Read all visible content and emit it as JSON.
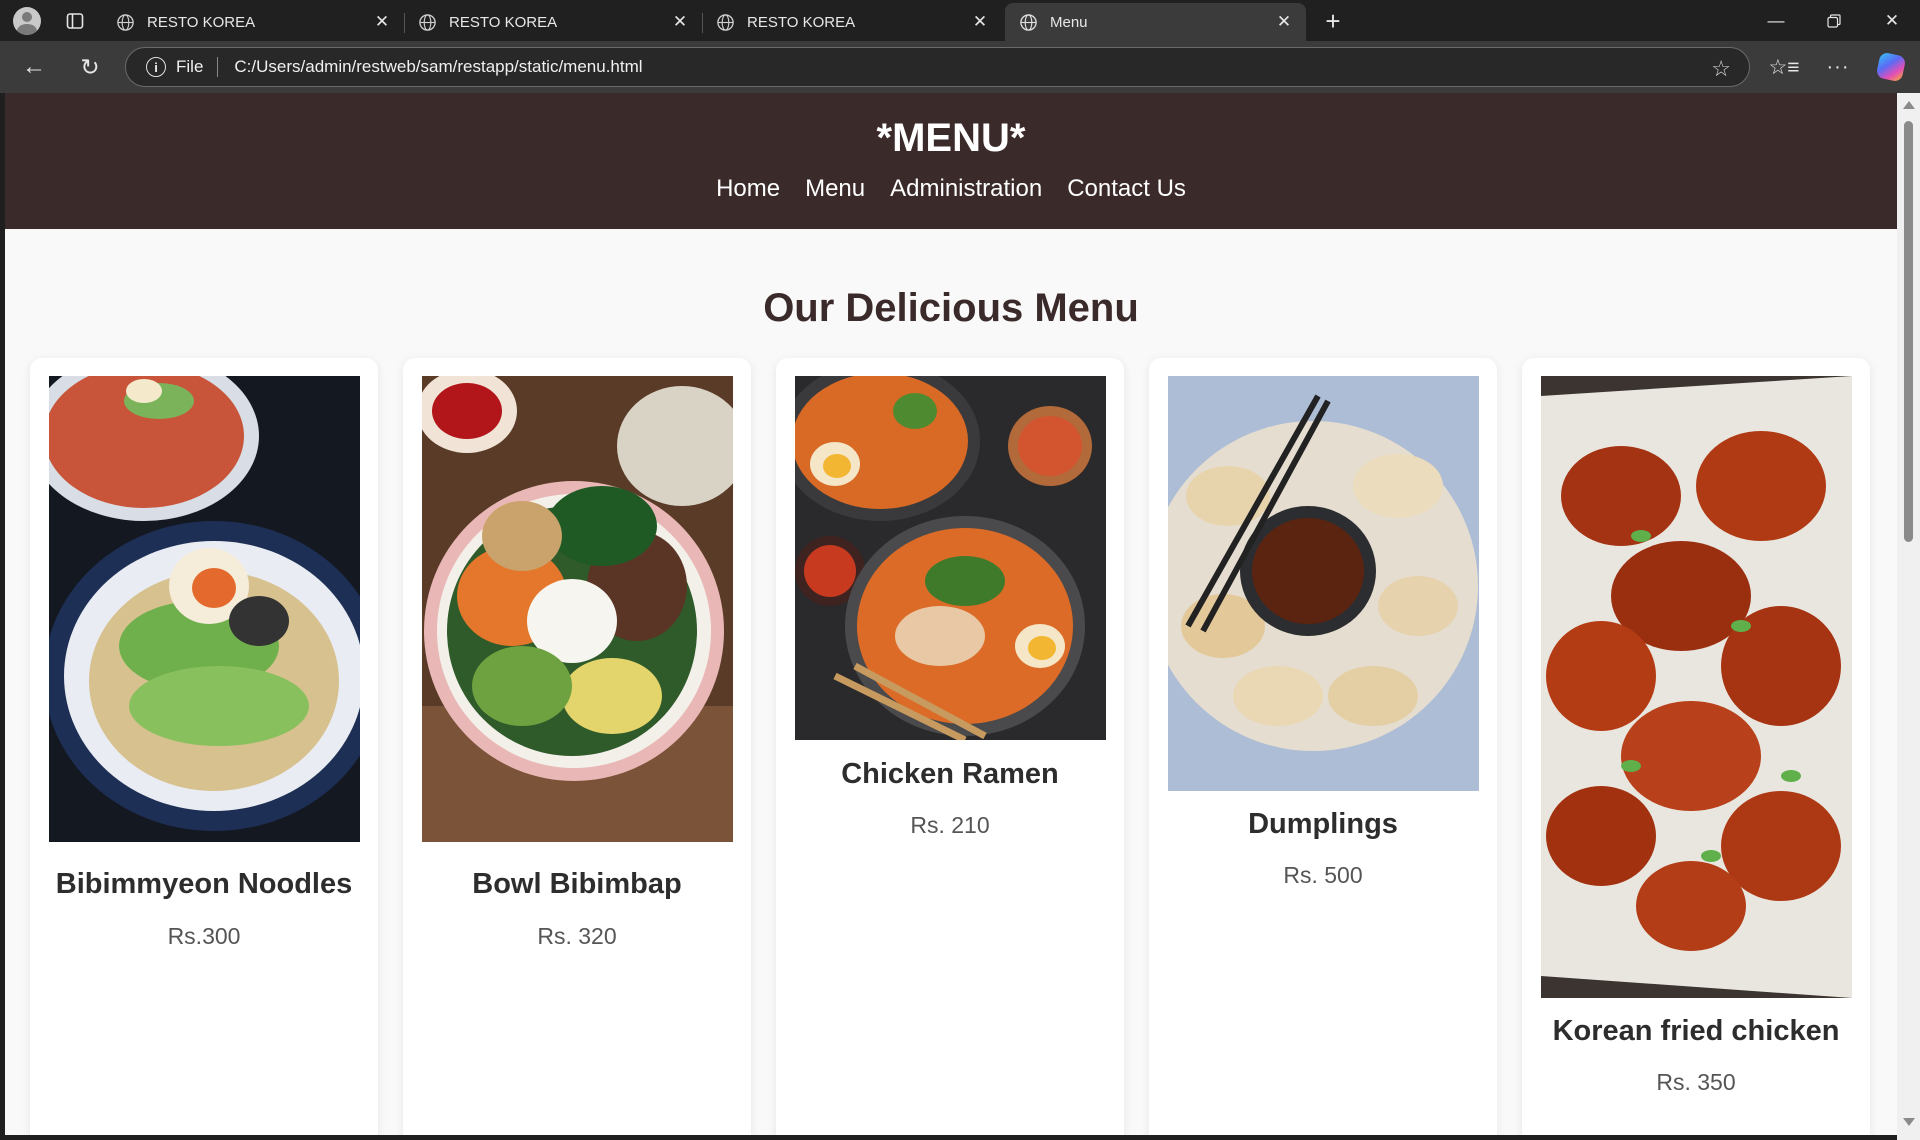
{
  "browser": {
    "tabs": [
      {
        "title": "RESTO KOREA",
        "active": false
      },
      {
        "title": "RESTO KOREA",
        "active": false
      },
      {
        "title": "RESTO KOREA",
        "active": false
      },
      {
        "title": "Menu",
        "active": true
      }
    ],
    "address": {
      "scheme_label": "File",
      "url": "C:/Users/admin/restweb/sam/restapp/static/menu.html"
    },
    "icons": {
      "profile": "avatar-icon",
      "tab_actions": "tab-actions-icon",
      "new_tab": "plus-icon",
      "minimize": "minimize-icon",
      "maximize": "restore-icon",
      "close": "close-icon",
      "back": "arrow-left-icon",
      "reload": "reload-icon",
      "favorite": "star-icon",
      "favorites": "favorites-icon",
      "more": "more-icon",
      "copilot": "copilot-icon"
    }
  },
  "site": {
    "title": "*MENU*",
    "nav": [
      {
        "label": "Home"
      },
      {
        "label": "Menu"
      },
      {
        "label": "Administration"
      },
      {
        "label": "Contact Us"
      }
    ]
  },
  "menu": {
    "heading": "Our Delicious Menu",
    "items": [
      {
        "name": "Bibimmyeon Noodles",
        "price": "Rs.300",
        "image": "bibimmyeon-noodles-photo"
      },
      {
        "name": "Bowl Bibimbap",
        "price": "Rs. 320",
        "image": "bowl-bibimbap-photo"
      },
      {
        "name": "Chicken Ramen",
        "price": "Rs. 210",
        "image": "chicken-ramen-photo"
      },
      {
        "name": "Dumplings",
        "price": "Rs. 500",
        "image": "dumplings-photo"
      },
      {
        "name": "Korean fried chicken",
        "price": "Rs. 350",
        "image": "korean-fried-chicken-photo"
      }
    ]
  },
  "colors": {
    "header_bg": "#3b2a2a",
    "page_bg": "#f9f9f9",
    "card_bg": "#ffffff",
    "heading_text": "#3b2a2a",
    "price_text": "#555555"
  }
}
